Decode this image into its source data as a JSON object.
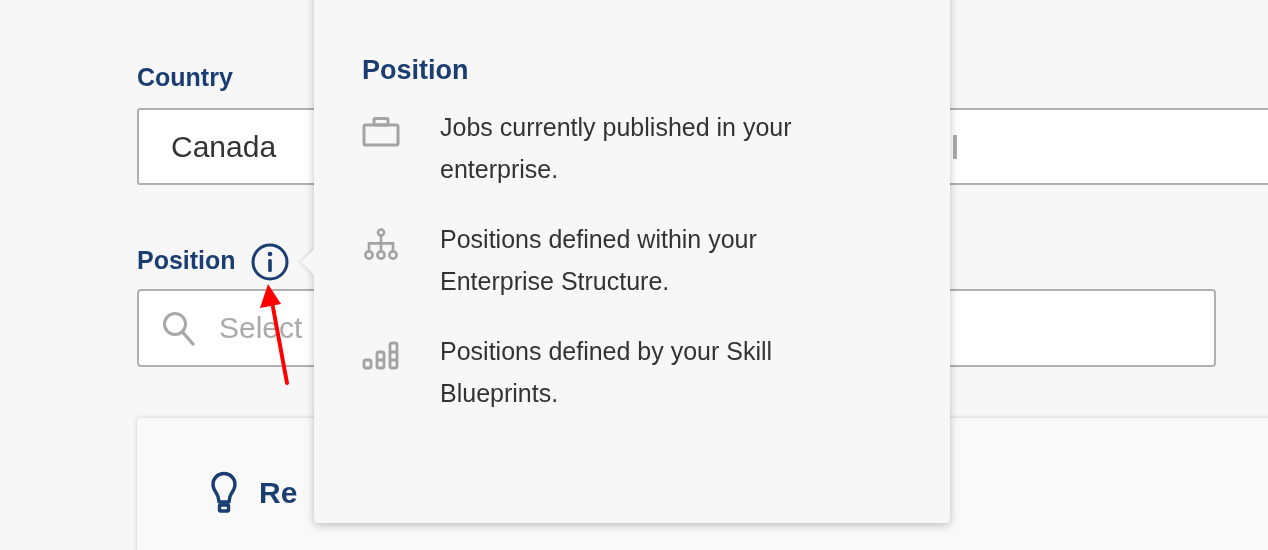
{
  "form": {
    "fields": [
      {
        "kind": "select",
        "label": "Country",
        "value": "Canada"
      },
      {
        "kind": "search",
        "label": "Position",
        "info": true,
        "placeholder": "Select"
      }
    ]
  },
  "card": {
    "title": "Re"
  },
  "popover": {
    "title": "Position",
    "items": [
      {
        "kind": "job",
        "text": "Jobs currently published in your enterprise."
      },
      {
        "kind": "structure",
        "text": "Positions defined within your Enterprise Structure."
      },
      {
        "kind": "blueprint",
        "text": "Positions defined by your Skill Blueprints."
      }
    ]
  }
}
